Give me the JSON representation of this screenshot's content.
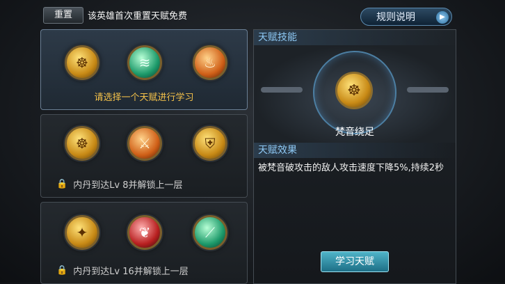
{
  "header": {
    "reset_label": "重置",
    "reset_note": "该英雄首次重置天赋免费",
    "rules_label": "规则说明",
    "rules_arrow_icon": "play-arrow-icon"
  },
  "tiers": [
    {
      "hint": "请选择一个天赋进行学习",
      "icons": [
        "golden-bell-icon",
        "jade-wind-icon",
        "flame-swirl-icon"
      ]
    },
    {
      "lock_text": "内丹到达Lv 8并解锁上一层",
      "icons": [
        "golden-bell-icon",
        "sword-strike-icon",
        "golden-shield-icon"
      ]
    },
    {
      "lock_text": "内丹到达Lv 16并解锁上一层",
      "icons": [
        "light-slash-icon",
        "crimson-wing-icon",
        "earth-blade-icon"
      ]
    }
  ],
  "detail": {
    "skills_title": "天赋技能",
    "skill_name": "梵音绕足",
    "effect_title": "天赋效果",
    "effect_text": "被梵音破攻击的敌人攻击速度下降5%,持续2秒",
    "learn_label": "学习天赋"
  }
}
